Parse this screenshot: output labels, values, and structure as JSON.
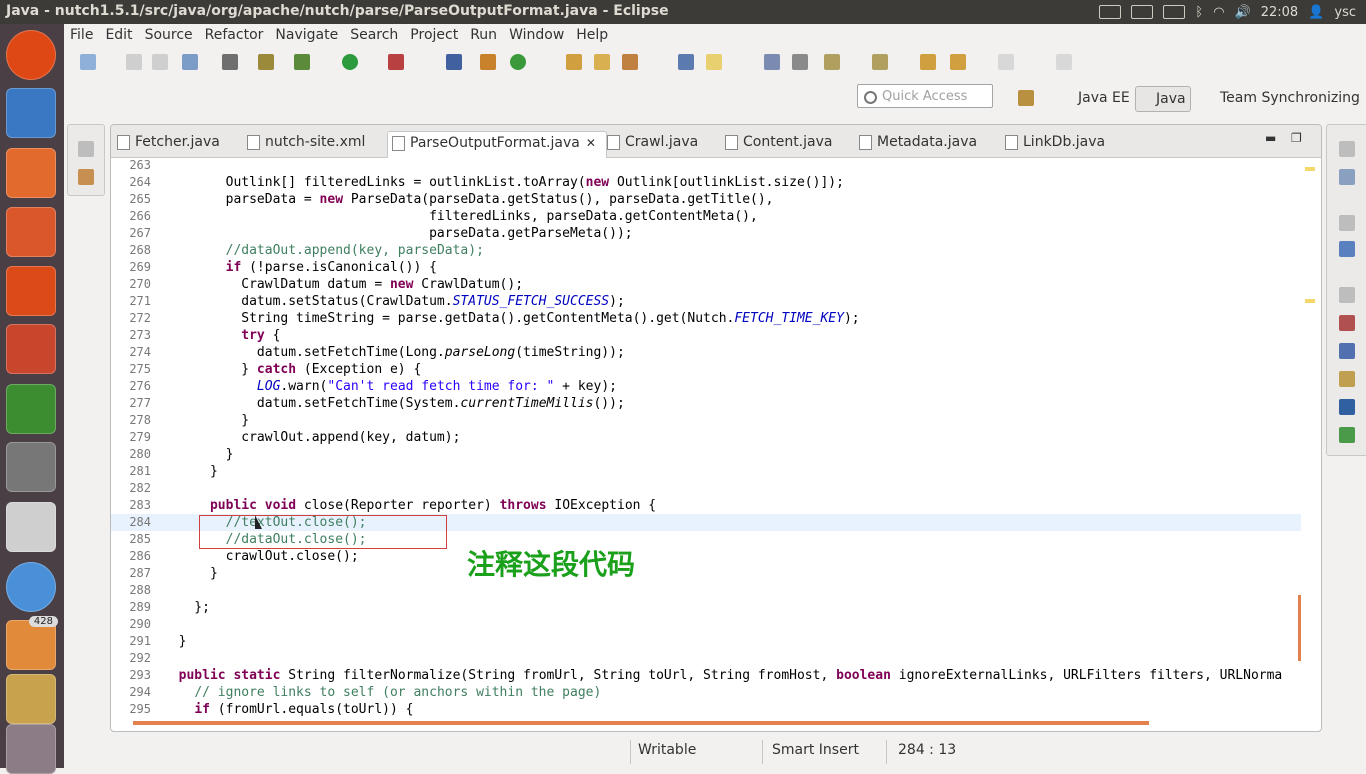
{
  "window": {
    "title": "Java - nutch1.5.1/src/java/org/apache/nutch/parse/ParseOutputFormat.java - Eclipse"
  },
  "tray": {
    "time": "22:08",
    "user": "ysc"
  },
  "launcher": {
    "badge": "428",
    "items": [
      "ubuntu-icon",
      "writer-icon",
      "files-icon",
      "software-center-icon",
      "ubuntu-one-icon",
      "settings-icon",
      "cube-icon",
      "help-icon",
      "text-editor-icon",
      "chrome-icon",
      "update-icon",
      "screenshot-icon",
      "trash-icon"
    ]
  },
  "menu": [
    "File",
    "Edit",
    "Source",
    "Refactor",
    "Navigate",
    "Search",
    "Project",
    "Run",
    "Window",
    "Help"
  ],
  "quick_access": {
    "placeholder": "Quick Access"
  },
  "perspectives": [
    "Java EE",
    "Java",
    "Team Synchronizing"
  ],
  "tabs": [
    "Fetcher.java",
    "nutch-site.xml",
    "ParseOutputFormat.java",
    "Crawl.java",
    "Content.java",
    "Metadata.java",
    "LinkDb.java"
  ],
  "code_lines": [
    {
      "n": "263",
      "t": ""
    },
    {
      "n": "264",
      "t": "        Outlink[] filteredLinks = outlinkList.toArray(new Outlink[outlinkList.size()]);"
    },
    {
      "n": "265",
      "t": "        parseData = new ParseData(parseData.getStatus(), parseData.getTitle(),"
    },
    {
      "n": "266",
      "t": "                                  filteredLinks, parseData.getContentMeta(),"
    },
    {
      "n": "267",
      "t": "                                  parseData.getParseMeta());"
    },
    {
      "n": "268",
      "t": "        //dataOut.append(key, parseData);"
    },
    {
      "n": "269",
      "t": "        if (!parse.isCanonical()) {"
    },
    {
      "n": "270",
      "t": "          CrawlDatum datum = new CrawlDatum();"
    },
    {
      "n": "271",
      "t": "          datum.setStatus(CrawlDatum.STATUS_FETCH_SUCCESS);"
    },
    {
      "n": "272",
      "t": "          String timeString = parse.getData().getContentMeta().get(Nutch.FETCH_TIME_KEY);"
    },
    {
      "n": "273",
      "t": "          try {"
    },
    {
      "n": "274",
      "t": "            datum.setFetchTime(Long.parseLong(timeString));"
    },
    {
      "n": "275",
      "t": "          } catch (Exception e) {"
    },
    {
      "n": "276",
      "t": "            LOG.warn(\"Can't read fetch time for: \" + key);"
    },
    {
      "n": "277",
      "t": "            datum.setFetchTime(System.currentTimeMillis());"
    },
    {
      "n": "278",
      "t": "          }"
    },
    {
      "n": "279",
      "t": "          crawlOut.append(key, datum);"
    },
    {
      "n": "280",
      "t": "        }"
    },
    {
      "n": "281",
      "t": "      }"
    },
    {
      "n": "282",
      "t": ""
    },
    {
      "n": "283",
      "t": "      public void close(Reporter reporter) throws IOException {"
    },
    {
      "n": "284",
      "t": "        //textOut.close();"
    },
    {
      "n": "285",
      "t": "        //dataOut.close();"
    },
    {
      "n": "286",
      "t": "        crawlOut.close();"
    },
    {
      "n": "287",
      "t": "      }"
    },
    {
      "n": "288",
      "t": ""
    },
    {
      "n": "289",
      "t": "    };"
    },
    {
      "n": "290",
      "t": ""
    },
    {
      "n": "291",
      "t": "  }"
    },
    {
      "n": "292",
      "t": ""
    },
    {
      "n": "293",
      "t": "  public static String filterNormalize(String fromUrl, String toUrl, String fromHost, boolean ignoreExternalLinks, URLFilters filters, URLNorma"
    },
    {
      "n": "294",
      "t": "    // ignore links to self (or anchors within the page)"
    },
    {
      "n": "295",
      "t": "    if (fromUrl.equals(toUrl)) {"
    }
  ],
  "annotation": "注释这段代码",
  "status": {
    "mode": "Writable",
    "insert": "Smart Insert",
    "position": "284 : 13"
  },
  "colors": {
    "keyword": "#7f0055",
    "comment": "#3f7f5f",
    "string": "#2a00ff",
    "field": "#0000c0",
    "annotation": "#1aa01a",
    "highlight_box": "#d04040"
  }
}
